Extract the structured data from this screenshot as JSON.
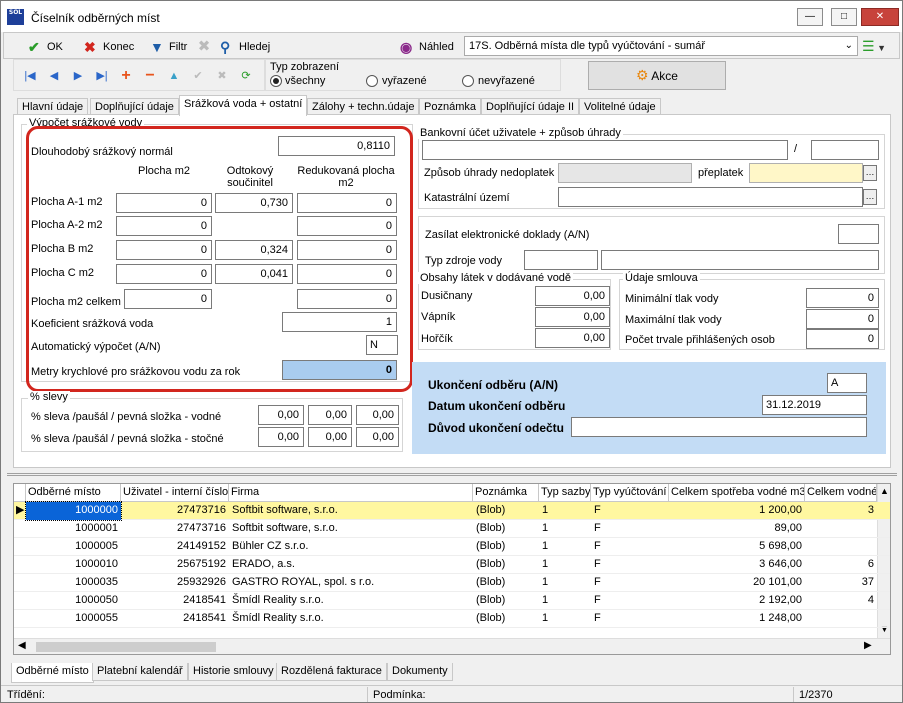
{
  "window": {
    "title": "Číselník odběrných míst",
    "logo": "SOL"
  },
  "toolbar": {
    "ok_label": "OK",
    "konec_label": "Konec",
    "filtr_label": "Filtr",
    "hledej_label": "Hledej",
    "nahled_label": "Náhled",
    "report_value": "17S. Odběrná místa dle typů vyúčtování - sumář",
    "akce_label": "Akce"
  },
  "display_type": {
    "title": "Typ zobrazení",
    "options": [
      "všechny",
      "vyřazené",
      "nevyřazené"
    ],
    "selected": "všechny"
  },
  "tabs": [
    "Hlavní údaje",
    "Doplňující údaje",
    "Srážková voda + ostatní",
    "Zálohy + techn.údaje",
    "Poznámka",
    "Doplňující údaje II",
    "Volitelné údaje"
  ],
  "active_tab": "Srážková voda + ostatní",
  "rain": {
    "group_title": "Výpočet srážkové vody",
    "longterm_label": "Dlouhodobý srážkový normál",
    "longterm_value": "0,8110",
    "col_area": "Plocha m2",
    "col_coef": "Odtokový součinitel",
    "col_reduced": "Redukovaná plocha m2",
    "rows": [
      {
        "label": "Plocha A-1 m2",
        "area": "0",
        "coef": "0,730",
        "reduced": "0"
      },
      {
        "label": "Plocha A-2 m2",
        "area": "0",
        "coef": "",
        "reduced": "0"
      },
      {
        "label": "Plocha B m2",
        "area": "0",
        "coef": "0,324",
        "reduced": "0"
      },
      {
        "label": "Plocha C m2",
        "area": "0",
        "coef": "0,041",
        "reduced": "0"
      }
    ],
    "total_label": "Plocha m2 celkem",
    "total_area": "0",
    "total_reduced": "0",
    "coef_label": "Koeficient srážková voda",
    "coef_value": "1",
    "auto_label": "Automatický výpočet (A/N)",
    "auto_value": "N",
    "cubic_label": "Metry krychlové  pro srážkovou vodu za rok",
    "cubic_value": "0"
  },
  "discounts": {
    "group_title": "% slevy",
    "row1_label": "% sleva /paušál / pevná složka - vodné",
    "row1_values": [
      "0,00",
      "0,00",
      "0,00"
    ],
    "row2_label": "% sleva /paušál / pevná složka - stočné",
    "row2_values": [
      "0,00",
      "0,00",
      "0,00"
    ]
  },
  "bank": {
    "group_title": "Bankovní účet uživatele + způsob úhrady",
    "account": "",
    "bank_code": "",
    "unpaid_label": "Způsob úhrady nedoplatek",
    "unpaid_value": "",
    "overpaid_label": "přeplatek",
    "overpaid_value": "",
    "cadastral_label": "Katastrální území",
    "cadastral_value": ""
  },
  "misc": {
    "edoc_label": "Zasílat elektronické doklady (A/N)",
    "edoc_value": "",
    "source_label": "Typ zdroje vody",
    "source_code": "",
    "source_name": ""
  },
  "substances": {
    "group_title": "Obsahy látek v dodávané vodě",
    "items": [
      {
        "label": "Dusičnany",
        "value": "0,00"
      },
      {
        "label": "Vápník",
        "value": "0,00"
      },
      {
        "label": "Hořčík",
        "value": "0,00"
      }
    ]
  },
  "contract": {
    "group_title": "Údaje smlouva",
    "items": [
      {
        "label": "Minimální tlak vody",
        "value": "0"
      },
      {
        "label": "Maximální tlak vody",
        "value": "0"
      },
      {
        "label": "Počet trvale přihlášených osob",
        "value": "0"
      }
    ]
  },
  "termination": {
    "end_label": "Ukončení odběru (A/N)",
    "end_value": "A",
    "date_label": "Datum ukončení odběru",
    "date_value": "31.12.2019",
    "reason_label": "Důvod ukončení odečtu",
    "reason_value": ""
  },
  "grid": {
    "columns": [
      "Odběrné místo",
      "Uživatel - interní číslo",
      "Firma",
      "Poznámka",
      "Typ sazby",
      "Typ vyúčtování",
      "Celkem spotřeba vodné m3",
      "Celkem vodné"
    ],
    "rows": [
      [
        "1000000",
        "27473716",
        "Softbit software, s.r.o.",
        "(Blob)",
        "1",
        "F",
        "1 200,00",
        "3"
      ],
      [
        "1000001",
        "27473716",
        "Softbit software, s.r.o.",
        "(Blob)",
        "1",
        "F",
        "89,00",
        ""
      ],
      [
        "1000005",
        "24149152",
        "Bühler CZ s.r.o.",
        "(Blob)",
        "1",
        "F",
        "5 698,00",
        ""
      ],
      [
        "1000010",
        "25675192",
        "ERADO, a.s.",
        "(Blob)",
        "1",
        "F",
        "3 646,00",
        "6"
      ],
      [
        "1000035",
        "25932926",
        "GASTRO ROYAL, spol. s r.o.",
        "(Blob)",
        "1",
        "F",
        "20 101,00",
        "37"
      ],
      [
        "1000050",
        "2418541",
        "Šmídl Reality s.r.o.",
        "(Blob)",
        "1",
        "F",
        "2 192,00",
        "4"
      ],
      [
        "1000055",
        "2418541",
        "Šmídl Reality s.r.o.",
        "(Blob)",
        "1",
        "F",
        "1 248,00",
        ""
      ]
    ]
  },
  "bottom_tabs": [
    "Odběrné místo",
    "Platební kalendář",
    "Historie smlouvy",
    "Rozdělená fakturace",
    "Dokumenty"
  ],
  "status": {
    "sort_label": "Třídění:",
    "condition_label": "Podmínka:",
    "position": "1/2370"
  },
  "colors": {
    "highlight_row": "#fff7a0",
    "selected_cell": "#0a64d8",
    "termination_bg": "#c3dcf5",
    "cubic_bg": "#a9ccef",
    "annotation_red": "#d2261e"
  }
}
